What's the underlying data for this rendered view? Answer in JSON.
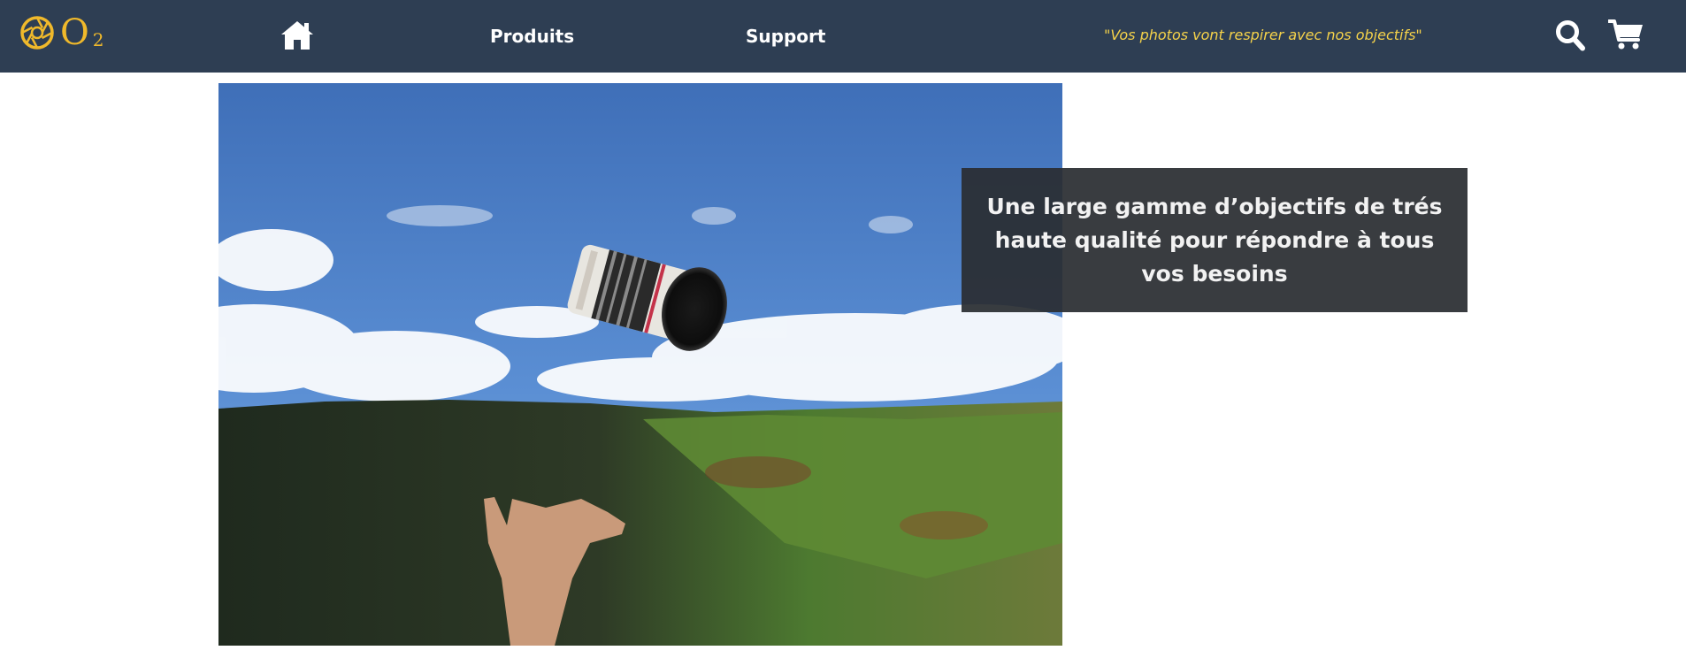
{
  "brand": {
    "letter": "O",
    "subscript": "2",
    "logo_icon": "aperture-icon",
    "color": "#f0b92b"
  },
  "nav": {
    "background": "#2e3e53",
    "home_icon": "home-icon",
    "links": [
      "Produits",
      "Support"
    ],
    "tagline": "\"Vos photos vont respirer avec nos objectifs\"",
    "search_icon": "search-icon",
    "cart_icon": "cart-icon"
  },
  "hero": {
    "image": "hand-tossing-camera-lens-over-mountain-valley",
    "caption": "Une large gamme d’objectifs de trés haute qualité pour répondre à tous vos besoins"
  }
}
